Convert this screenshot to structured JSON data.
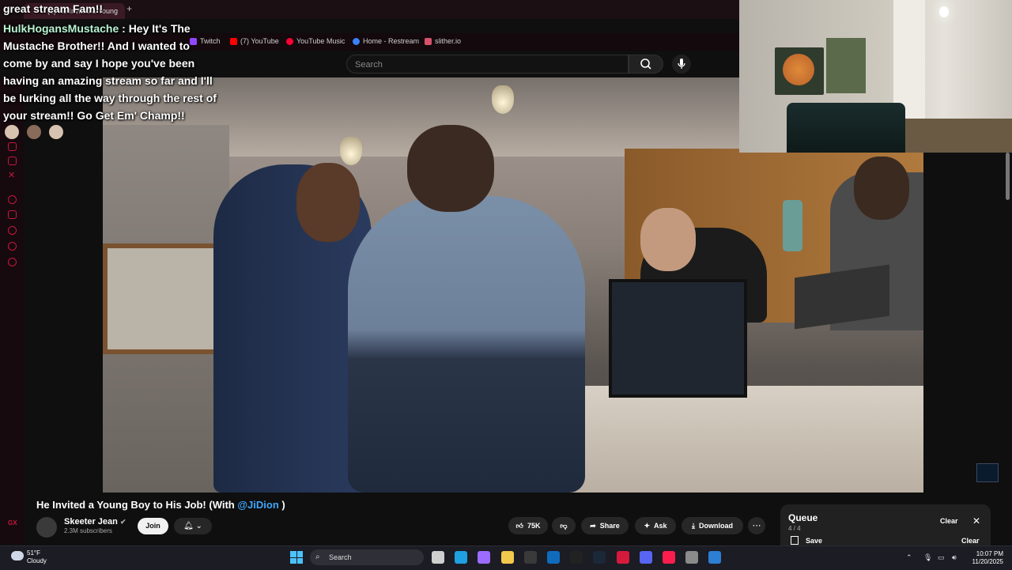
{
  "browser": {
    "tab_title": "(1) He Invited a Young",
    "new_tab": "+",
    "bookmarks": [
      {
        "label": "Twitch",
        "color": "#9146ff"
      },
      {
        "label": "(7) YouTube",
        "color": "#ff0000"
      },
      {
        "label": "YouTube Music",
        "color": "#ff0033"
      },
      {
        "label": "Home - Restream",
        "color": "#3b82f6"
      },
      {
        "label": "slither.io",
        "color": "#d7526b"
      }
    ]
  },
  "youtube": {
    "search_placeholder": "Search",
    "video": {
      "title_prefix": "He Invited a Young Boy to His Job! (With ",
      "title_link": "@JiDion",
      "title_suffix": " )"
    },
    "channel": {
      "name": "Skeeter Jean",
      "verified_icon": "✔",
      "subscribers": "2.3M subscribers"
    },
    "actions": {
      "join": "Join",
      "likes": "75K",
      "share": "Share",
      "ask": "Ask",
      "download": "Download",
      "more": "⋯"
    },
    "queue": {
      "title": "Queue",
      "count": "4 / 4",
      "clear": "Clear",
      "save": "Save",
      "clear2": "Clear",
      "close": "✕"
    }
  },
  "chat": {
    "prev_line": "great stream Fam!!",
    "username": "HulkHogansMustache",
    "message": ": Hey It's The Mustache Brother!! And I wanted to come by and say I hope you've been having an amazing stream so far and I'll be lurking all the way through the rest of your stream!! Go Get Em' Champ!!"
  },
  "taskbar": {
    "weather_temp": "51°F",
    "weather_desc": "Cloudy",
    "search": "Search",
    "time": "10:07 PM",
    "date": "11/20/2025",
    "apps": [
      {
        "name": "task-view",
        "color": "#cfcfcf"
      },
      {
        "name": "edge",
        "color": "#1fa0e0"
      },
      {
        "name": "copilot",
        "color": "#9b6cff"
      },
      {
        "name": "file-explorer",
        "color": "#f2c94c"
      },
      {
        "name": "calculator",
        "color": "#3a3a3a"
      },
      {
        "name": "outlook",
        "color": "#0f6cbd"
      },
      {
        "name": "x-app",
        "color": "#222"
      },
      {
        "name": "steam",
        "color": "#1b2838"
      },
      {
        "name": "opera",
        "color": "#d61a3c"
      },
      {
        "name": "discord",
        "color": "#5865f2"
      },
      {
        "name": "opera-gx",
        "color": "#fa1e4e"
      },
      {
        "name": "settings",
        "color": "#8a8a8a"
      },
      {
        "name": "app-blue",
        "color": "#2d7fd3"
      }
    ]
  }
}
